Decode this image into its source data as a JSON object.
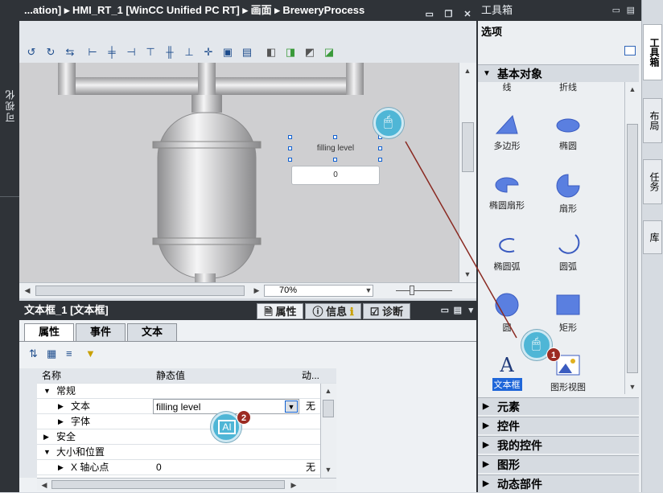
{
  "left_strip": {
    "label": "可视化"
  },
  "editor": {
    "breadcrumb": "...ation] ▸ HMI_RT_1 [WinCC Unified PC RT] ▸ 画面 ▸ BreweryProcess",
    "canvas_text_label": "filling level",
    "canvas_field_value": "0",
    "zoom": "70%"
  },
  "properties": {
    "header_title": "文本框_1 [文本框]",
    "outer_tabs": [
      "属性",
      "信息",
      "诊断"
    ],
    "inner_tabs": [
      "属性",
      "事件",
      "文本"
    ],
    "columns": {
      "name": "名称",
      "static": "静态值",
      "dynamic": "动..."
    },
    "rows": [
      {
        "name": "常规",
        "value": "",
        "dyn": ""
      },
      {
        "name": "文本",
        "value": "filling level",
        "dyn": "无"
      },
      {
        "name": "字体",
        "value": "",
        "dyn": ""
      },
      {
        "name": "安全",
        "value": "",
        "dyn": ""
      },
      {
        "name": "大小和位置",
        "value": "",
        "dyn": ""
      },
      {
        "name": "X 轴心点",
        "value": "0",
        "dyn": "无"
      }
    ]
  },
  "toolbox": {
    "title": "工具箱",
    "options": "选项",
    "basic_objects": "基本对象",
    "partial_top": [
      "线",
      "折线"
    ],
    "tools": [
      "多边形",
      "椭圆",
      "椭圆扇形",
      "扇形",
      "椭圆弧",
      "圆弧",
      "圆",
      "矩形",
      "文本框",
      "图形视图"
    ],
    "sections": [
      "元素",
      "控件",
      "我的控件",
      "图形",
      "动态部件"
    ]
  },
  "side_tabs": [
    "工具箱",
    "布局",
    "任务",
    "库"
  ],
  "callouts": [
    "1",
    "2"
  ],
  "colors": {
    "dark_chrome": "#2f3338",
    "accent_blue": "#4a6bd8",
    "callout_badge": "#9c2b22"
  }
}
